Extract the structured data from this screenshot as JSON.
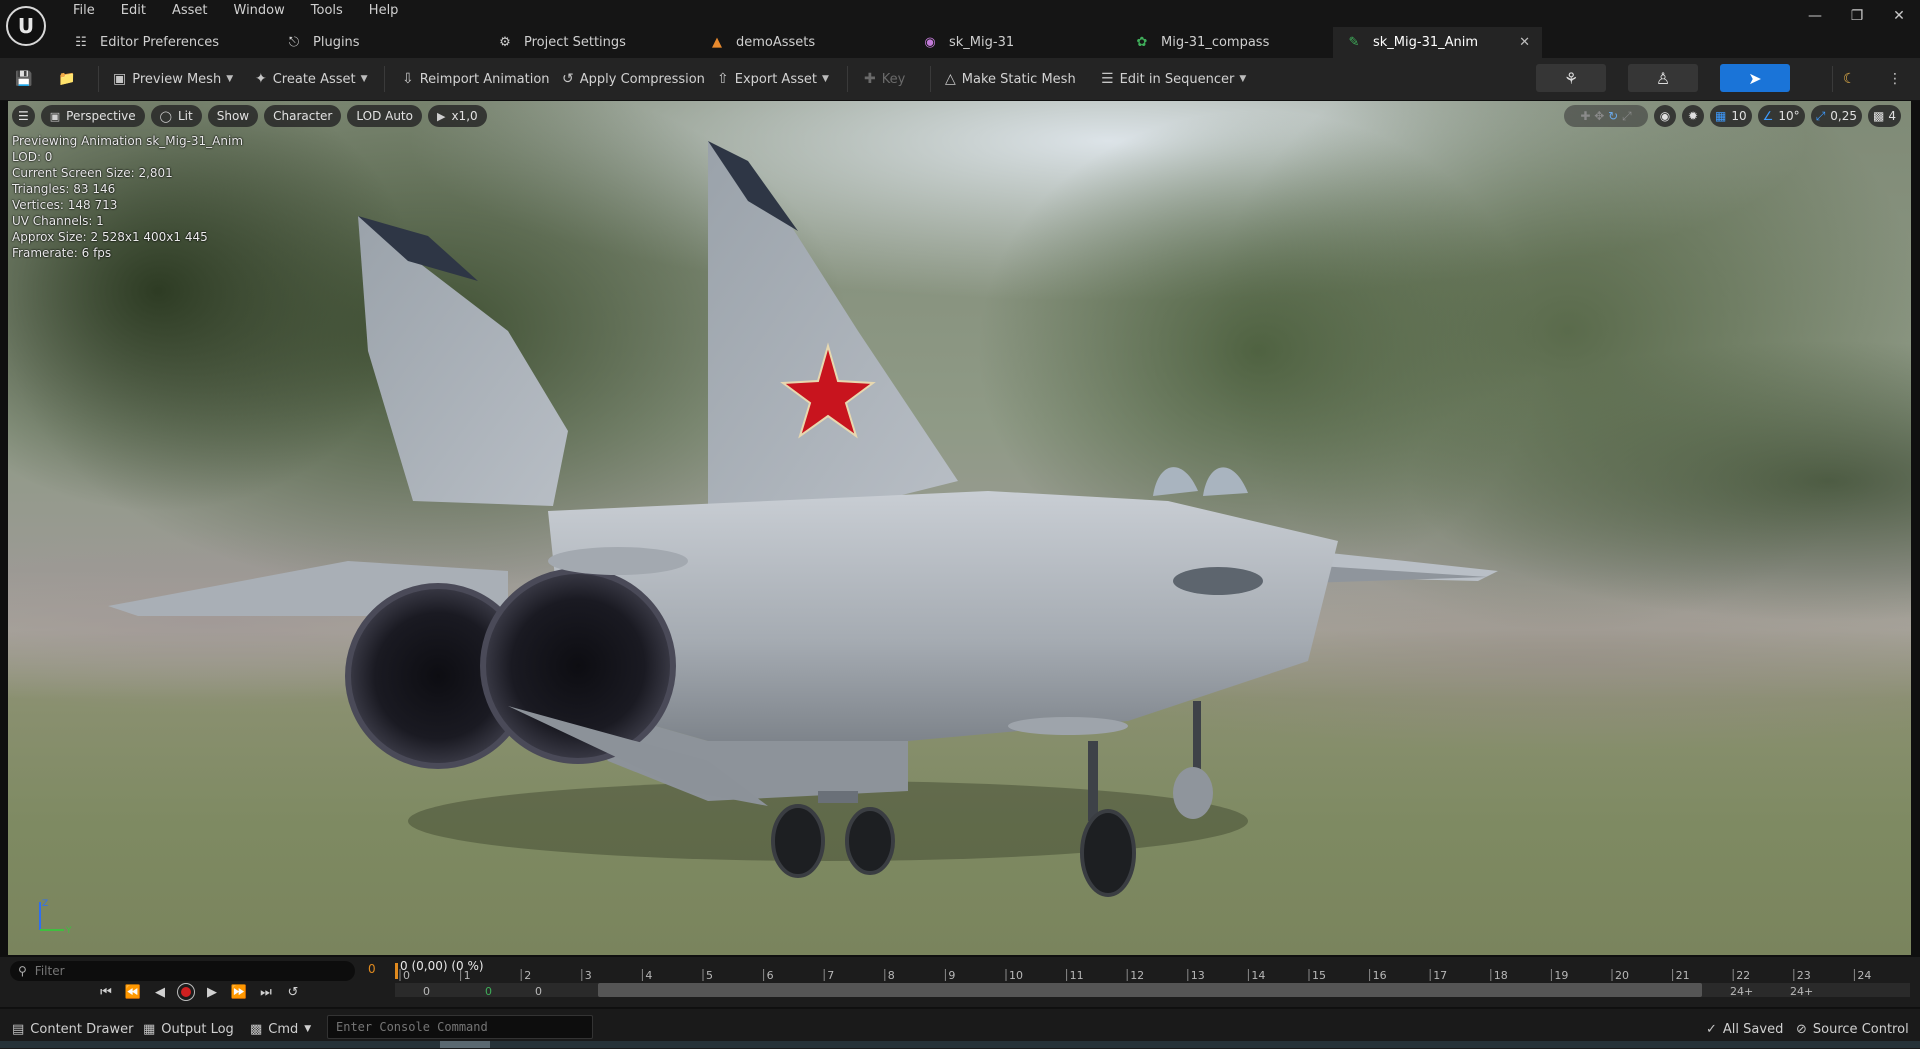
{
  "menu": [
    "File",
    "Edit",
    "Asset",
    "Window",
    "Tools",
    "Help"
  ],
  "tabs": [
    {
      "label": "Editor Preferences",
      "icon": "sliders-icon"
    },
    {
      "label": "Plugins",
      "icon": "plug-icon"
    },
    {
      "label": "Project Settings",
      "icon": "gear-icon"
    },
    {
      "label": "demoAssets",
      "icon": "map-icon",
      "icon_color": "#e88a2e"
    },
    {
      "label": "sk_Mig-31",
      "icon": "skeletal-mesh-icon",
      "icon_color": "#c27ad8"
    },
    {
      "label": "Mig-31_compass",
      "icon": "skeleton-icon",
      "icon_color": "#3fae5a"
    },
    {
      "label": "sk_Mig-31_Anim",
      "icon": "animation-icon",
      "icon_color": "#3fae5a",
      "active": true
    }
  ],
  "toolbar": {
    "preview_mesh": "Preview Mesh",
    "create_asset": "Create Asset",
    "reimport_animation": "Reimport Animation",
    "apply_compression": "Apply Compression",
    "export_asset": "Export Asset",
    "key": "Key",
    "make_static_mesh": "Make Static Mesh",
    "edit_in_sequencer": "Edit in Sequencer"
  },
  "viewport": {
    "toolbar": {
      "perspective": "Perspective",
      "lit": "Lit",
      "show": "Show",
      "character": "Character",
      "lod": "LOD Auto",
      "play_rate": "x1,0"
    },
    "right_toolbar": {
      "grid_snap": "10",
      "rotation_snap": "10°",
      "scale_snap": "0,25",
      "camera_speed": "4"
    },
    "stats": [
      "Previewing Animation sk_Mig-31_Anim",
      "LOD: 0",
      "Current Screen Size: 2,801",
      "Triangles: 83 146",
      "Vertices: 148 713",
      "UV Channels: 1",
      "Approx Size: 2 528x1 400x1 445",
      "Framerate: 6 fps"
    ],
    "axis": {
      "z": "Z",
      "y": "Y"
    }
  },
  "timeline": {
    "filter_placeholder": "Filter",
    "start_frame": "0",
    "playhead_label": "0 (0,00) (0 %)",
    "ticks": [
      "0",
      "1",
      "2",
      "3",
      "4",
      "5",
      "6",
      "7",
      "8",
      "9",
      "10",
      "11",
      "12",
      "13",
      "14",
      "15",
      "16",
      "17",
      "18",
      "19",
      "20",
      "21",
      "22",
      "23",
      "24"
    ],
    "secondary_ticks": [
      "0",
      "0",
      "0",
      "24+",
      "24+"
    ],
    "accent_color": "#e08a1e"
  },
  "statusbar": {
    "content_drawer": "Content Drawer",
    "output_log": "Output Log",
    "cmd": "Cmd",
    "console_placeholder": "Enter Console Command",
    "all_saved": "All Saved",
    "source_control": "Source Control"
  },
  "colors": {
    "accent_blue": "#1a74d8",
    "panel_bg": "#242424",
    "star_red": "#c8141e"
  }
}
